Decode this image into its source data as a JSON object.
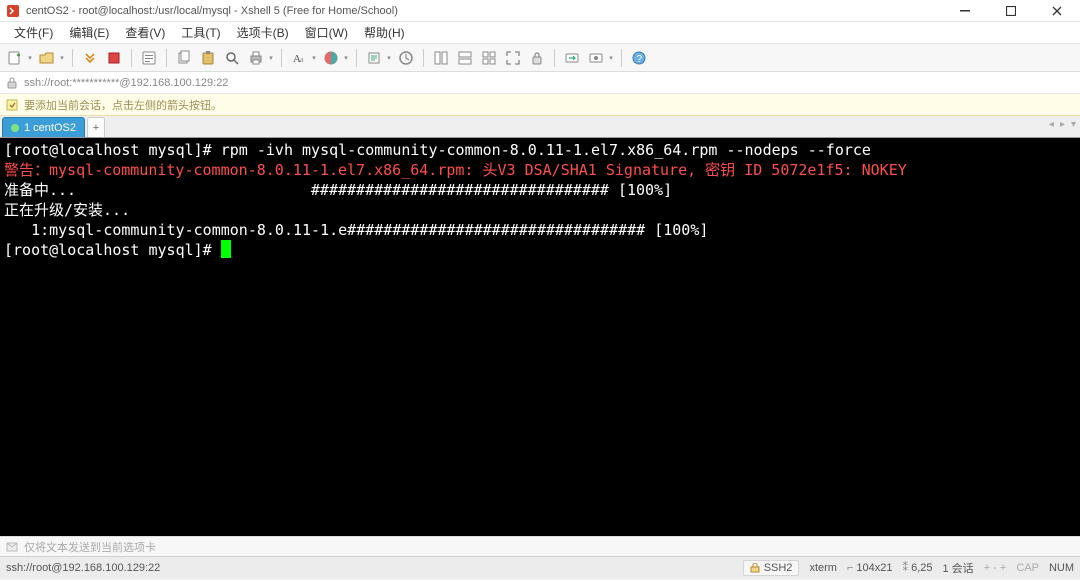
{
  "window": {
    "title": "centOS2 - root@localhost:/usr/local/mysql - Xshell 5 (Free for Home/School)"
  },
  "menu": {
    "items": [
      "文件(F)",
      "编辑(E)",
      "查看(V)",
      "工具(T)",
      "选项卡(B)",
      "窗口(W)",
      "帮助(H)"
    ]
  },
  "address": {
    "text": "ssh://root:***********@192.168.100.129:22"
  },
  "hint": {
    "text": "要添加当前会话，点击左侧的箭头按钮。"
  },
  "tabs": {
    "items": [
      "1 centOS2"
    ],
    "add": "+"
  },
  "terminal": {
    "lines": [
      "[root@localhost mysql]# rpm -ivh mysql-community-common-8.0.11-1.el7.x86_64.rpm --nodeps --force",
      "警告：mysql-community-common-8.0.11-1.el7.x86_64.rpm: 头V3 DSA/SHA1 Signature, 密钥 ID 5072e1f5: NOKEY",
      "准备中...                          ################################# [100%]",
      "正在升级/安装...",
      "   1:mysql-community-common-8.0.11-1.e################################# [100%]",
      "[root@localhost mysql]# "
    ],
    "warning_line_index": 1
  },
  "sendbar": {
    "text": "仅将文本发送到当前选项卡"
  },
  "status": {
    "left": "ssh://root@192.168.100.129:22",
    "ssh": "SSH2",
    "term": "xterm",
    "size": "104x21",
    "pos": "6,25",
    "sessions": "1 会话",
    "cap": "CAP",
    "num": "NUM"
  },
  "icons": {
    "app": "app-icon",
    "lock": "lock-icon",
    "info": "info-icon",
    "send": "send-icon"
  }
}
